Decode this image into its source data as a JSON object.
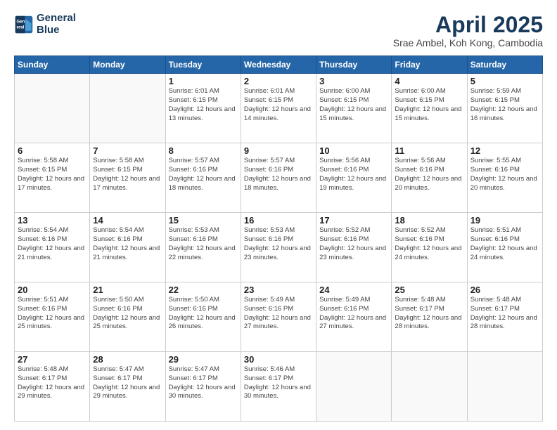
{
  "header": {
    "logo_line1": "General",
    "logo_line2": "Blue",
    "title": "April 2025",
    "subtitle": "Srae Ambel, Koh Kong, Cambodia"
  },
  "calendar": {
    "days_of_week": [
      "Sunday",
      "Monday",
      "Tuesday",
      "Wednesday",
      "Thursday",
      "Friday",
      "Saturday"
    ],
    "weeks": [
      [
        {
          "day": "",
          "info": ""
        },
        {
          "day": "",
          "info": ""
        },
        {
          "day": "1",
          "info": "Sunrise: 6:01 AM\nSunset: 6:15 PM\nDaylight: 12 hours\nand 13 minutes."
        },
        {
          "day": "2",
          "info": "Sunrise: 6:01 AM\nSunset: 6:15 PM\nDaylight: 12 hours\nand 14 minutes."
        },
        {
          "day": "3",
          "info": "Sunrise: 6:00 AM\nSunset: 6:15 PM\nDaylight: 12 hours\nand 15 minutes."
        },
        {
          "day": "4",
          "info": "Sunrise: 6:00 AM\nSunset: 6:15 PM\nDaylight: 12 hours\nand 15 minutes."
        },
        {
          "day": "5",
          "info": "Sunrise: 5:59 AM\nSunset: 6:15 PM\nDaylight: 12 hours\nand 16 minutes."
        }
      ],
      [
        {
          "day": "6",
          "info": "Sunrise: 5:58 AM\nSunset: 6:15 PM\nDaylight: 12 hours\nand 17 minutes."
        },
        {
          "day": "7",
          "info": "Sunrise: 5:58 AM\nSunset: 6:15 PM\nDaylight: 12 hours\nand 17 minutes."
        },
        {
          "day": "8",
          "info": "Sunrise: 5:57 AM\nSunset: 6:16 PM\nDaylight: 12 hours\nand 18 minutes."
        },
        {
          "day": "9",
          "info": "Sunrise: 5:57 AM\nSunset: 6:16 PM\nDaylight: 12 hours\nand 18 minutes."
        },
        {
          "day": "10",
          "info": "Sunrise: 5:56 AM\nSunset: 6:16 PM\nDaylight: 12 hours\nand 19 minutes."
        },
        {
          "day": "11",
          "info": "Sunrise: 5:56 AM\nSunset: 6:16 PM\nDaylight: 12 hours\nand 20 minutes."
        },
        {
          "day": "12",
          "info": "Sunrise: 5:55 AM\nSunset: 6:16 PM\nDaylight: 12 hours\nand 20 minutes."
        }
      ],
      [
        {
          "day": "13",
          "info": "Sunrise: 5:54 AM\nSunset: 6:16 PM\nDaylight: 12 hours\nand 21 minutes."
        },
        {
          "day": "14",
          "info": "Sunrise: 5:54 AM\nSunset: 6:16 PM\nDaylight: 12 hours\nand 21 minutes."
        },
        {
          "day": "15",
          "info": "Sunrise: 5:53 AM\nSunset: 6:16 PM\nDaylight: 12 hours\nand 22 minutes."
        },
        {
          "day": "16",
          "info": "Sunrise: 5:53 AM\nSunset: 6:16 PM\nDaylight: 12 hours\nand 23 minutes."
        },
        {
          "day": "17",
          "info": "Sunrise: 5:52 AM\nSunset: 6:16 PM\nDaylight: 12 hours\nand 23 minutes."
        },
        {
          "day": "18",
          "info": "Sunrise: 5:52 AM\nSunset: 6:16 PM\nDaylight: 12 hours\nand 24 minutes."
        },
        {
          "day": "19",
          "info": "Sunrise: 5:51 AM\nSunset: 6:16 PM\nDaylight: 12 hours\nand 24 minutes."
        }
      ],
      [
        {
          "day": "20",
          "info": "Sunrise: 5:51 AM\nSunset: 6:16 PM\nDaylight: 12 hours\nand 25 minutes."
        },
        {
          "day": "21",
          "info": "Sunrise: 5:50 AM\nSunset: 6:16 PM\nDaylight: 12 hours\nand 25 minutes."
        },
        {
          "day": "22",
          "info": "Sunrise: 5:50 AM\nSunset: 6:16 PM\nDaylight: 12 hours\nand 26 minutes."
        },
        {
          "day": "23",
          "info": "Sunrise: 5:49 AM\nSunset: 6:16 PM\nDaylight: 12 hours\nand 27 minutes."
        },
        {
          "day": "24",
          "info": "Sunrise: 5:49 AM\nSunset: 6:16 PM\nDaylight: 12 hours\nand 27 minutes."
        },
        {
          "day": "25",
          "info": "Sunrise: 5:48 AM\nSunset: 6:17 PM\nDaylight: 12 hours\nand 28 minutes."
        },
        {
          "day": "26",
          "info": "Sunrise: 5:48 AM\nSunset: 6:17 PM\nDaylight: 12 hours\nand 28 minutes."
        }
      ],
      [
        {
          "day": "27",
          "info": "Sunrise: 5:48 AM\nSunset: 6:17 PM\nDaylight: 12 hours\nand 29 minutes."
        },
        {
          "day": "28",
          "info": "Sunrise: 5:47 AM\nSunset: 6:17 PM\nDaylight: 12 hours\nand 29 minutes."
        },
        {
          "day": "29",
          "info": "Sunrise: 5:47 AM\nSunset: 6:17 PM\nDaylight: 12 hours\nand 30 minutes."
        },
        {
          "day": "30",
          "info": "Sunrise: 5:46 AM\nSunset: 6:17 PM\nDaylight: 12 hours\nand 30 minutes."
        },
        {
          "day": "",
          "info": ""
        },
        {
          "day": "",
          "info": ""
        },
        {
          "day": "",
          "info": ""
        }
      ]
    ]
  }
}
